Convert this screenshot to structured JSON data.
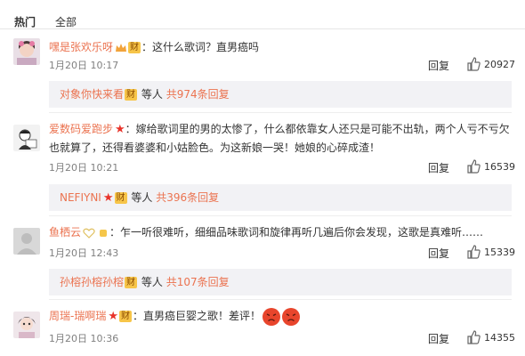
{
  "tabs": {
    "hot": "热门",
    "all": "全部"
  },
  "comments": [
    {
      "username": "嘿是张欢乐呀",
      "text": "：这什么歌词？直男癌吗",
      "time": "1月20日 10:17",
      "reply_label": "回复",
      "likes": "20927",
      "sub": {
        "name": "对象你快来看",
        "middle": "等人",
        "count": "共974条回复"
      }
    },
    {
      "username": "爱数码爱跑步",
      "text_line1": "：嫁给歌词里的男的太惨了，什么都依靠女人还只是可能不出轨，两个人亏不亏欠",
      "text_line2": "也就算了，还得看婆婆和小姑脸色。为这新娘一哭！她娘的心碎成渣！",
      "time": "1月20日 10:21",
      "reply_label": "回复",
      "likes": "16539",
      "sub": {
        "name": "NEFIYNI",
        "middle": "等人",
        "count": "共396条回复"
      }
    },
    {
      "username": "鱼栖云",
      "text": "：乍一听很难听，细细品味歌词和旋律再听几遍后你会发现，这歌是真难听……",
      "time": "1月20日 12:43",
      "reply_label": "回复",
      "likes": "15339",
      "sub": {
        "name": "孙榕孙榕孙榕",
        "middle": "等人",
        "count": "共107条回复"
      }
    },
    {
      "username": "周瑞-瑞啊瑞",
      "text": "：直男癌巨婴之歌！差评！",
      "time": "1月20日 10:36",
      "reply_label": "回复",
      "likes": "14355"
    }
  ],
  "badges": {
    "cai": "财"
  },
  "colors": {
    "username": "#eb7350",
    "subbox_bg": "#f2f2f5",
    "meta": "#808080"
  },
  "icons": [
    "thumbs-up-icon",
    "star-badge-icon",
    "crown-badge-icon",
    "angry-face-icon"
  ]
}
